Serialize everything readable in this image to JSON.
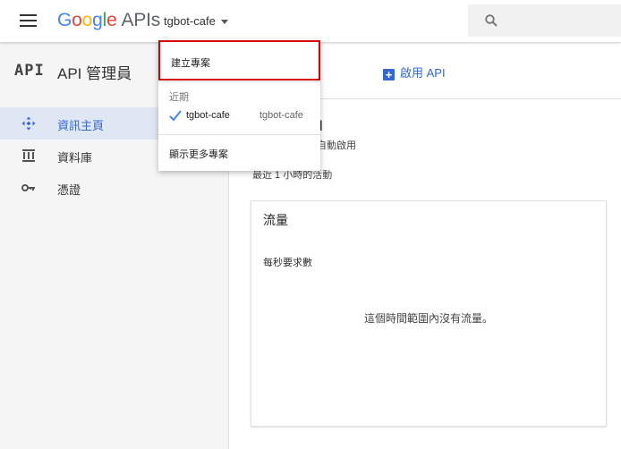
{
  "header": {
    "brand": {
      "letters": [
        "G",
        "o",
        "o",
        "g",
        "l",
        "e"
      ],
      "suffix": "APIs",
      "colors": [
        "#4285F4",
        "#EA4335",
        "#FBBC05",
        "#4285F4",
        "#34A853",
        "#EA4335"
      ]
    },
    "project_name": "tgbot-cafe",
    "icons": {
      "menu": "hamburger-menu-icon",
      "caret": "caret-down-icon",
      "search": "search-icon"
    }
  },
  "sidebar": {
    "logo_text": "API",
    "title": "API 管理員",
    "items": [
      {
        "label": "資訊主頁",
        "icon": "dashboard-icon",
        "active": true
      },
      {
        "label": "資料庫",
        "icon": "library-icon",
        "active": false
      },
      {
        "label": "憑證",
        "icon": "key-icon",
        "active": false
      }
    ]
  },
  "main": {
    "enable_api_label": "啟用 API",
    "title_partial": "PI",
    "subtitle_partial": "統自動啟用",
    "recent_activity_partial": "最近 1 小時的活動",
    "traffic_card": {
      "title": "流量",
      "metric_label": "每秒要求數",
      "empty_message": "這個時間範圍內沒有流量。"
    }
  },
  "dropdown": {
    "create_project": "建立專案",
    "recent_label": "近期",
    "recent_projects": [
      {
        "name": "tgbot-cafe",
        "id": "tgbot-cafe",
        "selected": true
      }
    ],
    "show_more": "顯示更多專案"
  },
  "colors": {
    "accent": "#3367d6",
    "highlight_border": "#d50000",
    "sidebar_active_bg": "#dfe7f5",
    "check": "#4285F4"
  }
}
